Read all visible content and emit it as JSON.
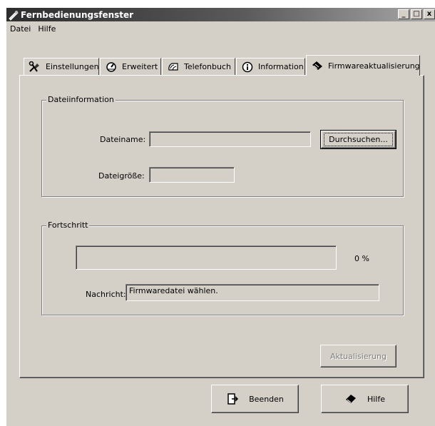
{
  "window": {
    "title": "Fernbedienungsfenster",
    "controls": {
      "minimize": "_",
      "maximize": "□",
      "close": "x"
    }
  },
  "menu": [
    {
      "label": "Datei",
      "icon": "none"
    },
    {
      "label": "Hilfe",
      "icon": "none"
    }
  ],
  "tabs": [
    {
      "label": "Einstellungen",
      "icon": "tools-icon"
    },
    {
      "label": "Erweitert",
      "icon": "gauge-icon"
    },
    {
      "label": "Telefonbuch",
      "icon": "phonebook-icon"
    },
    {
      "label": "Information",
      "icon": "info-icon"
    },
    {
      "label": "Firmwareaktualisierung",
      "icon": "chip-icon",
      "active": true
    }
  ],
  "file_info": {
    "legend": "Dateiinformation",
    "filename_label": "Dateiname:",
    "filename_value": "",
    "browse_button": "Durchsuchen...",
    "filesize_label": "Dateigröße:",
    "filesize_value": ""
  },
  "progress": {
    "legend": "Fortschritt",
    "percent_text": "0 %",
    "percent_value": 0,
    "message_label": "Nachricht:",
    "message_value": "Firmwaredatei wählen."
  },
  "update_button": {
    "label": "Aktualisierung",
    "enabled": false
  },
  "footer": {
    "exit_button": "Beenden",
    "help_button": "Hilfe"
  }
}
